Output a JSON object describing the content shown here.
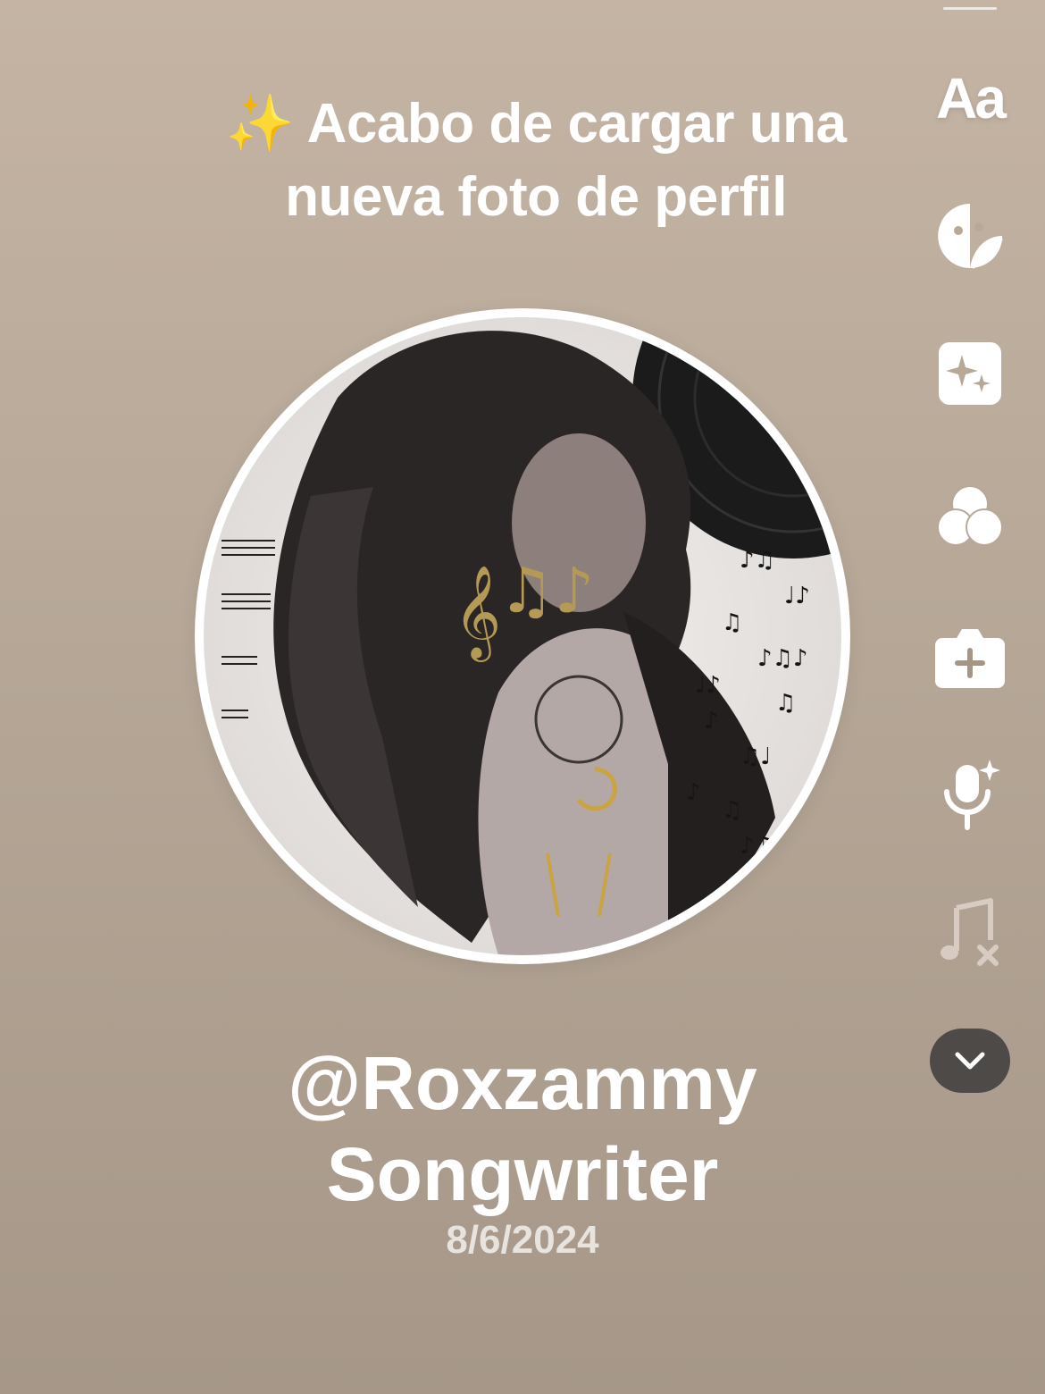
{
  "headline": {
    "emoji": "✨",
    "line1": "Acabo de cargar una",
    "line2": "nueva foto de perfil"
  },
  "profile": {
    "handle": "@Roxzammy",
    "role": "Songwriter",
    "date": "8/6/2024"
  },
  "toolbar": {
    "text_tool_label": "Aa",
    "items": [
      "text-tool",
      "sticker-icon",
      "effects-icon",
      "filters-icon",
      "add-camera-icon",
      "voice-effects-icon",
      "music-off-icon",
      "collapse-chevron-icon"
    ]
  },
  "colors": {
    "background_top": "#c5b4a4",
    "background_bottom": "#a69788",
    "collapse_button": "#4d4a47",
    "sparkle": "#f5c542"
  }
}
